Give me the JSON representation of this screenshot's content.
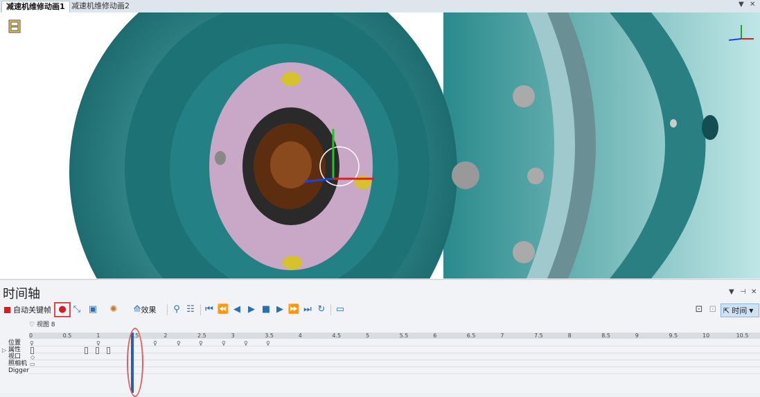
{
  "tabs": [
    {
      "label": "减速机维修动画1",
      "active": true
    },
    {
      "label": "减速机维修动画2",
      "active": false
    }
  ],
  "tab_controls": {
    "dropdown": "▼",
    "close": "✕"
  },
  "viewport": {
    "film_icon": "film-icon",
    "gizmo": "axis-gizmo"
  },
  "timeline": {
    "title": "时间轴",
    "controls": {
      "dropdown": "▼",
      "pin": "⊣",
      "close": "✕"
    },
    "toolbar": {
      "auto_key_label": "自动关键帧",
      "effects_label": "效果",
      "time_label": "时间"
    },
    "view_label": "视图 8",
    "ruler_ticks": [
      "0",
      "0.5",
      "1",
      "1.5",
      "2",
      "2.5",
      "3",
      "3.5",
      "4",
      "4.5",
      "5",
      "5.5",
      "6",
      "6.5",
      "7",
      "7.5",
      "8",
      "8.5",
      "9",
      "9.5",
      "10",
      "10.5"
    ],
    "tracks": [
      "位置",
      "属性",
      "视口",
      "照相机",
      "Digger"
    ]
  },
  "colors": {
    "teal": "#1d6f73",
    "accent": "#2f5da8",
    "highlight": "#e04848"
  }
}
